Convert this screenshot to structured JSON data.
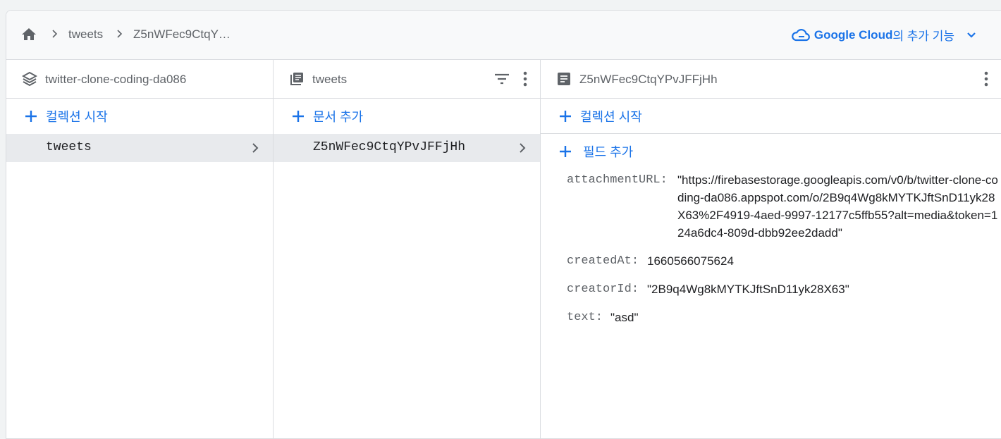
{
  "breadcrumb": {
    "items": [
      "tweets",
      "Z5nWFec9CtqY…"
    ]
  },
  "google_cloud": {
    "brand": "Google Cloud",
    "suffix": "의 추가 기능"
  },
  "columns": {
    "root": {
      "title": "twitter-clone-coding-da086",
      "add_label": "컬렉션 시작",
      "items": [
        "tweets"
      ]
    },
    "collection": {
      "title": "tweets",
      "add_label": "문서 추가",
      "items": [
        "Z5nWFec9CtqYPvJFFjHh"
      ]
    },
    "document": {
      "title": "Z5nWFec9CtqYPvJFFjHh",
      "add_collection_label": "컬렉션 시작",
      "add_field_label": "필드 추가",
      "fields": [
        {
          "key": "attachmentURL:",
          "value": "\"https://firebasestorage.googleapis.com/v0/b/twitter-clone-coding-da086.appspot.com/o/2B9q4Wg8kMYTKJftSnD11yk28X63%2F4919-4aed-9997-12177c5ffb55?alt=media&token=124a6dc4-809d-dbb92ee2dadd\""
        },
        {
          "key": "createdAt:",
          "value": "1660566075624"
        },
        {
          "key": "creatorId:",
          "value": "\"2B9q4Wg8kMYTKJftSnD11yk28X63\""
        },
        {
          "key": "text:",
          "value": "\"asd\""
        }
      ]
    }
  },
  "colors": {
    "accent": "#1a73e8",
    "selected_row": "#e8eaed",
    "border": "#dadce0"
  },
  "icons": [
    "home-icon",
    "chevron-right-icon",
    "cloud-icon",
    "chevron-down-icon",
    "database-icon",
    "collection-icon",
    "document-icon",
    "filter-icon",
    "more-vert-icon",
    "plus-icon"
  ]
}
